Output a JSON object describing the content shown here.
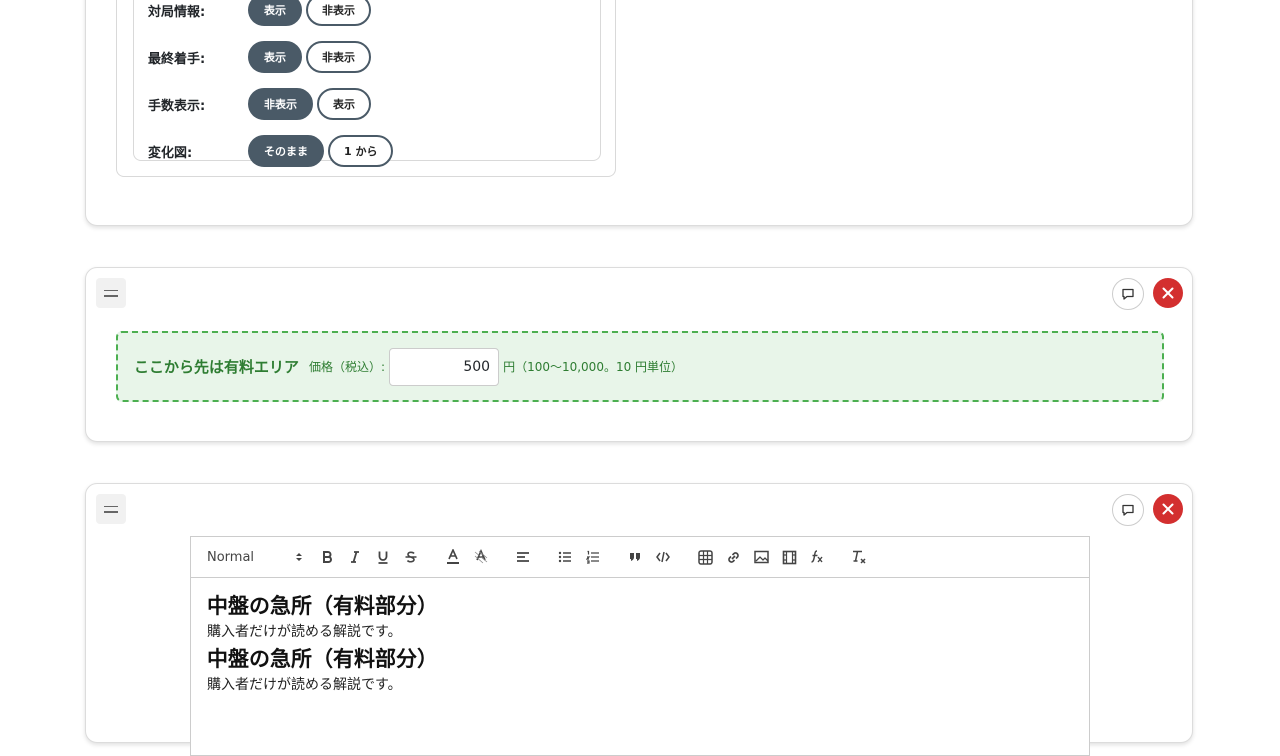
{
  "options": {
    "rows": [
      {
        "label": "対局情報:",
        "active": "表示",
        "inactive": "非表示"
      },
      {
        "label": "最終着手:",
        "active": "表示",
        "inactive": "非表示"
      },
      {
        "label": "手数表示:",
        "active": "非表示",
        "inactive": "表示"
      },
      {
        "label": "変化図:",
        "active": "そのまま",
        "inactive": "1 から"
      }
    ]
  },
  "paid_block": {
    "title": "ここから先は有料エリア",
    "price_label": "価格（税込）:",
    "price_value": "500",
    "price_note": "円（100〜10,000。10 円単位）"
  },
  "editor": {
    "format_select": "Normal",
    "content": [
      {
        "heading": "中盤の急所（有料部分）",
        "paragraph": "購入者だけが読める解説です。"
      },
      {
        "heading": "中盤の急所（有料部分）",
        "paragraph": "購入者だけが読める解説です。"
      }
    ]
  },
  "colors": {
    "pill_active": "#4a5a67",
    "paid_border": "#4caf50",
    "paid_background": "#e8f5e9",
    "paid_text": "#2e7d32",
    "delete_button": "#d32f2f"
  },
  "icons": [
    "drag-handle-icon",
    "comment-icon",
    "close-icon",
    "bold-icon",
    "italic-icon",
    "underline-icon",
    "strike-icon",
    "text-color-icon",
    "background-color-icon",
    "align-icon",
    "bullet-list-icon",
    "ordered-list-icon",
    "blockquote-icon",
    "code-block-icon",
    "table-icon",
    "link-icon",
    "image-icon",
    "video-icon",
    "formula-icon",
    "clear-format-icon"
  ]
}
